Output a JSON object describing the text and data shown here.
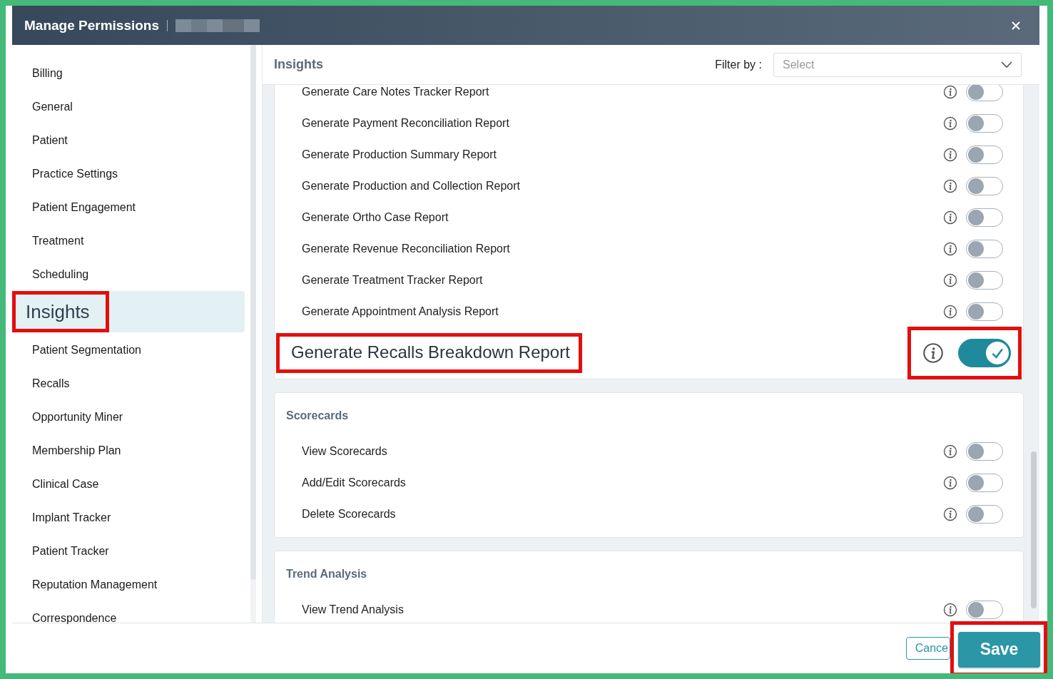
{
  "window": {
    "title": "Manage Permissions"
  },
  "sidebar": {
    "items": [
      {
        "label": "Billing",
        "selected": false,
        "highlighted": false
      },
      {
        "label": "General",
        "selected": false,
        "highlighted": false
      },
      {
        "label": "Patient",
        "selected": false,
        "highlighted": false
      },
      {
        "label": "Practice Settings",
        "selected": false,
        "highlighted": false
      },
      {
        "label": "Patient Engagement",
        "selected": false,
        "highlighted": false
      },
      {
        "label": "Treatment",
        "selected": false,
        "highlighted": false
      },
      {
        "label": "Scheduling",
        "selected": false,
        "highlighted": false
      },
      {
        "label": "Insights",
        "selected": true,
        "highlighted": true
      },
      {
        "label": "Patient Segmentation",
        "selected": false,
        "highlighted": false
      },
      {
        "label": "Recalls",
        "selected": false,
        "highlighted": false
      },
      {
        "label": "Opportunity Miner",
        "selected": false,
        "highlighted": false
      },
      {
        "label": "Membership Plan",
        "selected": false,
        "highlighted": false
      },
      {
        "label": "Clinical Case",
        "selected": false,
        "highlighted": false
      },
      {
        "label": "Implant Tracker",
        "selected": false,
        "highlighted": false
      },
      {
        "label": "Patient Tracker",
        "selected": false,
        "highlighted": false
      },
      {
        "label": "Reputation Management",
        "selected": false,
        "highlighted": false
      },
      {
        "label": "Correspondence",
        "selected": false,
        "highlighted": false
      }
    ]
  },
  "content": {
    "title": "Insights",
    "filter": {
      "label": "Filter by :",
      "placeholder": "Select"
    },
    "sections": [
      {
        "permissions": [
          {
            "label": "Generate Care Notes Tracker Report",
            "on": false,
            "highlighted": false
          },
          {
            "label": "Generate Payment Reconciliation Report",
            "on": false,
            "highlighted": false
          },
          {
            "label": "Generate Production Summary Report",
            "on": false,
            "highlighted": false
          },
          {
            "label": "Generate Production and Collection Report",
            "on": false,
            "highlighted": false
          },
          {
            "label": "Generate Ortho Case Report",
            "on": false,
            "highlighted": false
          },
          {
            "label": "Generate Revenue Reconciliation Report",
            "on": false,
            "highlighted": false
          },
          {
            "label": "Generate Treatment Tracker Report",
            "on": false,
            "highlighted": false
          },
          {
            "label": "Generate Appointment Analysis Report",
            "on": false,
            "highlighted": false
          },
          {
            "label": "Generate Recalls Breakdown Report",
            "on": true,
            "highlighted": true
          }
        ]
      },
      {
        "title": "Scorecards",
        "permissions": [
          {
            "label": "View Scorecards",
            "on": false,
            "highlighted": false
          },
          {
            "label": "Add/Edit Scorecards",
            "on": false,
            "highlighted": false
          },
          {
            "label": "Delete Scorecards",
            "on": false,
            "highlighted": false
          }
        ]
      },
      {
        "title": "Trend Analysis",
        "permissions": [
          {
            "label": "View Trend Analysis",
            "on": false,
            "highlighted": false
          }
        ]
      }
    ]
  },
  "footer": {
    "buttons": [
      {
        "label": "Cance",
        "kind": "secondary",
        "highlighted": false
      },
      {
        "label": "Save",
        "kind": "primary",
        "highlighted": true
      }
    ]
  }
}
